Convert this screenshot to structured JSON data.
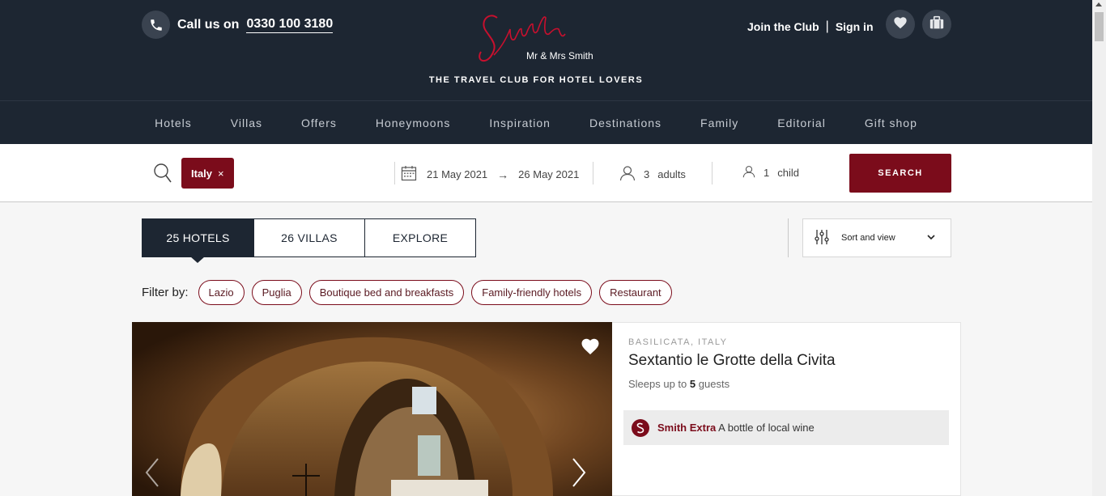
{
  "header": {
    "call_prefix": "Call us on",
    "phone": "0330 100 3180",
    "logo_script": "Smith",
    "logo_sub": "Mr & Mrs Smith",
    "tagline": "THE TRAVEL CLUB FOR HOTEL LOVERS",
    "join": "Join the Club",
    "separator": "|",
    "signin": "Sign in",
    "icons": [
      "phone-icon",
      "heart-icon",
      "suitcase-icon"
    ]
  },
  "nav": {
    "items": [
      "Hotels",
      "Villas",
      "Offers",
      "Honeymoons",
      "Inspiration",
      "Destinations",
      "Family",
      "Editorial",
      "Gift shop"
    ]
  },
  "search": {
    "location_tag": "Italy",
    "remove": "×",
    "check_in": "21 May 2021",
    "arrow": "→",
    "check_out": "26 May 2021",
    "adults_count": "3",
    "adults_label": "adults",
    "children_count": "1",
    "children_label": "child",
    "button": "SEARCH"
  },
  "tabs": [
    "25 HOTELS",
    "26 VILLAS",
    "EXPLORE"
  ],
  "sort": {
    "label": "Sort and view"
  },
  "filters": {
    "label": "Filter by:",
    "chips": [
      "Lazio",
      "Puglia",
      "Boutique bed and breakfasts",
      "Family-friendly hotels",
      "Restaurant"
    ]
  },
  "listing": {
    "region": "BASILICATA, ITALY",
    "name": "Sextantio le Grotte della Civita",
    "sleeps_prefix": "Sleeps up to",
    "sleeps_count": "5",
    "sleeps_suffix": "guests",
    "extra_label": "Smith Extra",
    "extra_text": "A bottle of local wine"
  },
  "colors": {
    "header_bg": "#1d2632",
    "accent": "#7b0c1b",
    "page_bg": "#f6f6f6"
  }
}
